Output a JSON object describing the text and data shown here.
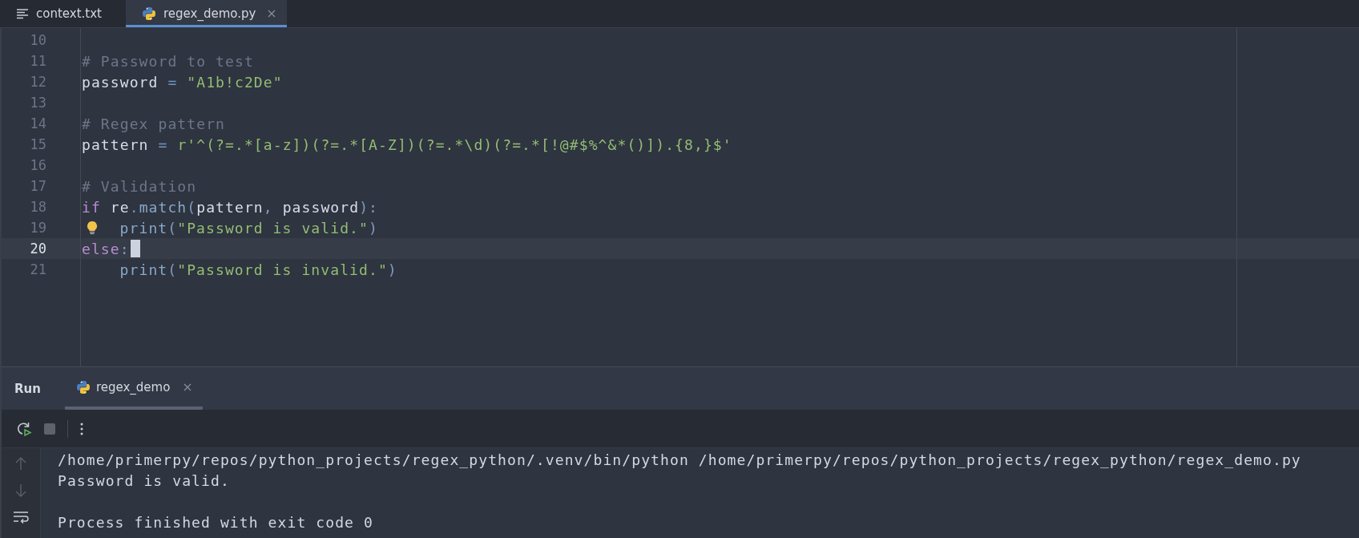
{
  "editor_tabs": [
    {
      "label": "context.txt",
      "selected": false
    },
    {
      "label": "regex_demo.py",
      "selected": true
    }
  ],
  "editor": {
    "lines": [
      {
        "number": "10",
        "current": false
      },
      {
        "number": "11",
        "current": false,
        "tokens": [
          {
            "kind": "comment",
            "text": "# Password to test"
          }
        ]
      },
      {
        "number": "12",
        "current": false,
        "tokens": [
          {
            "kind": "plain",
            "text": "password"
          },
          {
            "kind": "op",
            "text": " = "
          },
          {
            "kind": "string",
            "text": "\"A1b!c2De\""
          }
        ]
      },
      {
        "number": "13",
        "current": false
      },
      {
        "number": "14",
        "current": false,
        "tokens": [
          {
            "kind": "comment",
            "text": "# Regex pattern"
          }
        ]
      },
      {
        "number": "15",
        "current": false,
        "tokens": [
          {
            "kind": "plain",
            "text": "pattern"
          },
          {
            "kind": "op",
            "text": " = "
          },
          {
            "kind": "string",
            "text": "r'^(?=.*[a-z])(?=.*[A-Z])(?=.*\\d)(?=.*[!@#$%^&*()]).{8,}$'"
          }
        ]
      },
      {
        "number": "16",
        "current": false
      },
      {
        "number": "17",
        "current": false,
        "tokens": [
          {
            "kind": "comment",
            "text": "# Validation"
          }
        ]
      },
      {
        "number": "18",
        "current": false,
        "tokens": [
          {
            "kind": "keyword",
            "text": "if"
          },
          {
            "kind": "plain",
            "text": " re"
          },
          {
            "kind": "op",
            "text": "."
          },
          {
            "kind": "call",
            "text": "match"
          },
          {
            "kind": "punct",
            "text": "("
          },
          {
            "kind": "plain",
            "text": "pattern"
          },
          {
            "kind": "punct",
            "text": ", "
          },
          {
            "kind": "plain",
            "text": "password"
          },
          {
            "kind": "punct",
            "text": "):"
          }
        ]
      },
      {
        "number": "19",
        "current": false,
        "indented": true,
        "hint": true,
        "tokens": [
          {
            "kind": "call",
            "text": "print"
          },
          {
            "kind": "punct",
            "text": "("
          },
          {
            "kind": "string",
            "text": "\"Password is valid.\""
          },
          {
            "kind": "punct",
            "text": ")"
          }
        ]
      },
      {
        "number": "20",
        "current": true,
        "tokens": [
          {
            "kind": "keyword",
            "text": "else"
          },
          {
            "kind": "punct",
            "text": ":"
          }
        ]
      },
      {
        "number": "21",
        "current": false,
        "indented": true,
        "tokens": [
          {
            "kind": "call",
            "text": "print"
          },
          {
            "kind": "punct",
            "text": "("
          },
          {
            "kind": "string",
            "text": "\"Password is invalid.\""
          },
          {
            "kind": "punct",
            "text": ")"
          }
        ]
      }
    ]
  },
  "run_panel": {
    "title": "Run",
    "tabs": [
      {
        "label": "regex_demo",
        "selected": true
      }
    ],
    "console": {
      "command": "/home/primerpy/repos/python_projects/regex_python/.venv/bin/python /home/primerpy/repos/python_projects/regex_python/regex_demo.py",
      "output": [
        "Password is valid."
      ],
      "exit_message": "Process finished with exit code 0"
    }
  }
}
